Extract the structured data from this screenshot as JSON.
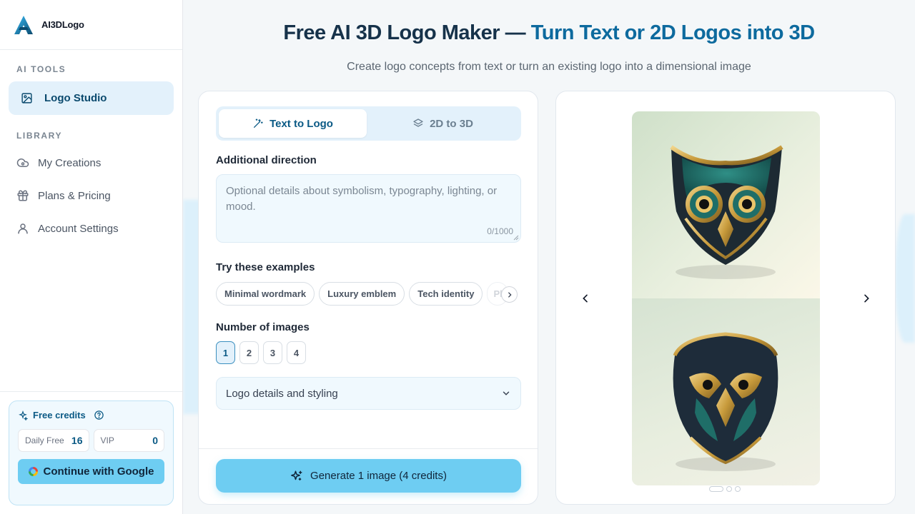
{
  "app": {
    "name": "AI3DLogo"
  },
  "sidebar": {
    "ai_tools_label": "AI TOOLS",
    "logo_studio": "Logo Studio",
    "library_label": "LIBRARY",
    "library_items": [
      {
        "label": "My Creations",
        "icon": "cloud-icon"
      },
      {
        "label": "Plans & Pricing",
        "icon": "gift-icon"
      },
      {
        "label": "Account Settings",
        "icon": "user-icon"
      }
    ],
    "credits": {
      "title": "Free credits",
      "daily_label": "Daily Free",
      "daily_value": "16",
      "vip_label": "VIP",
      "vip_value": "0",
      "google_button": "Continue with Google"
    }
  },
  "header": {
    "title_main": "Free AI 3D Logo Maker — ",
    "title_accent": "Turn Text or 2D Logos into 3D",
    "subtitle": "Create logo concepts from text or turn an existing logo into a dimensional image"
  },
  "form": {
    "tabs": [
      {
        "label": "Text to Logo"
      },
      {
        "label": "2D to 3D"
      }
    ],
    "direction_label": "Additional direction",
    "direction_placeholder": "Optional details about symbolism, typography, lighting, or mood.",
    "direction_counter": "0/1000",
    "examples_label": "Try these examples",
    "examples": [
      "Minimal wordmark",
      "Luxury emblem",
      "Tech identity",
      "Pl"
    ],
    "count_label": "Number of images",
    "counts": [
      "1",
      "2",
      "3",
      "4"
    ],
    "selected_count": "1",
    "details_select": "Logo details and styling",
    "generate_button": "Generate 1 image (4 credits)"
  },
  "preview": {
    "slides_total": 3,
    "active_slide": 1
  },
  "colors": {
    "accent": "#0d6a9e",
    "button": "#6ecdf2",
    "active_bg": "#e3f1fb"
  }
}
